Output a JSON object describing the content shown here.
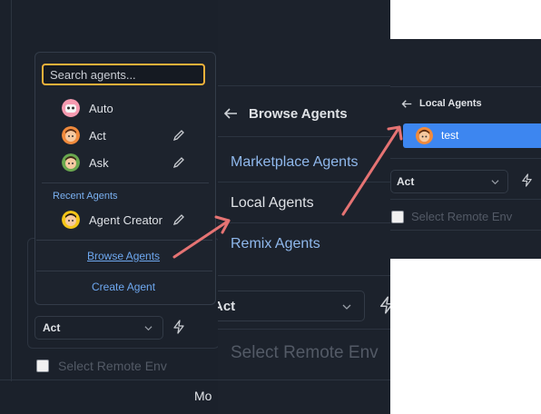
{
  "panel1": {
    "search_placeholder": "Search agents...",
    "agents": [
      {
        "label": "Auto",
        "icon": "auto-avatar-icon"
      },
      {
        "label": "Act",
        "icon": "act-avatar-icon"
      },
      {
        "label": "Ask",
        "icon": "ask-avatar-icon"
      }
    ],
    "recent_heading": "Recent Agents",
    "recent": [
      {
        "label": "Agent Creator",
        "icon": "agent-creator-avatar-icon"
      }
    ],
    "browse_agents": "Browse Agents",
    "create_agent": "Create Agent",
    "mode_select": "Act",
    "remote_env": "Select Remote Env",
    "footer_text": "Mo"
  },
  "panel2": {
    "back_title": "Browse Agents",
    "items": [
      "Marketplace Agents",
      "Local Agents",
      "Remix Agents"
    ],
    "mode_select": "Act",
    "remote_env": "Select Remote Env"
  },
  "panel3": {
    "back_title": "Local Agents",
    "selected_item": "test",
    "mode_select": "Act",
    "remote_env": "Select Remote Env"
  },
  "colors": {
    "panel_bg": "#1b212b",
    "accent_link": "#6ea8f0",
    "focus_border": "#f2b13a",
    "selected_bg": "#3d86f0",
    "annotation_arrow": "#e57373"
  }
}
